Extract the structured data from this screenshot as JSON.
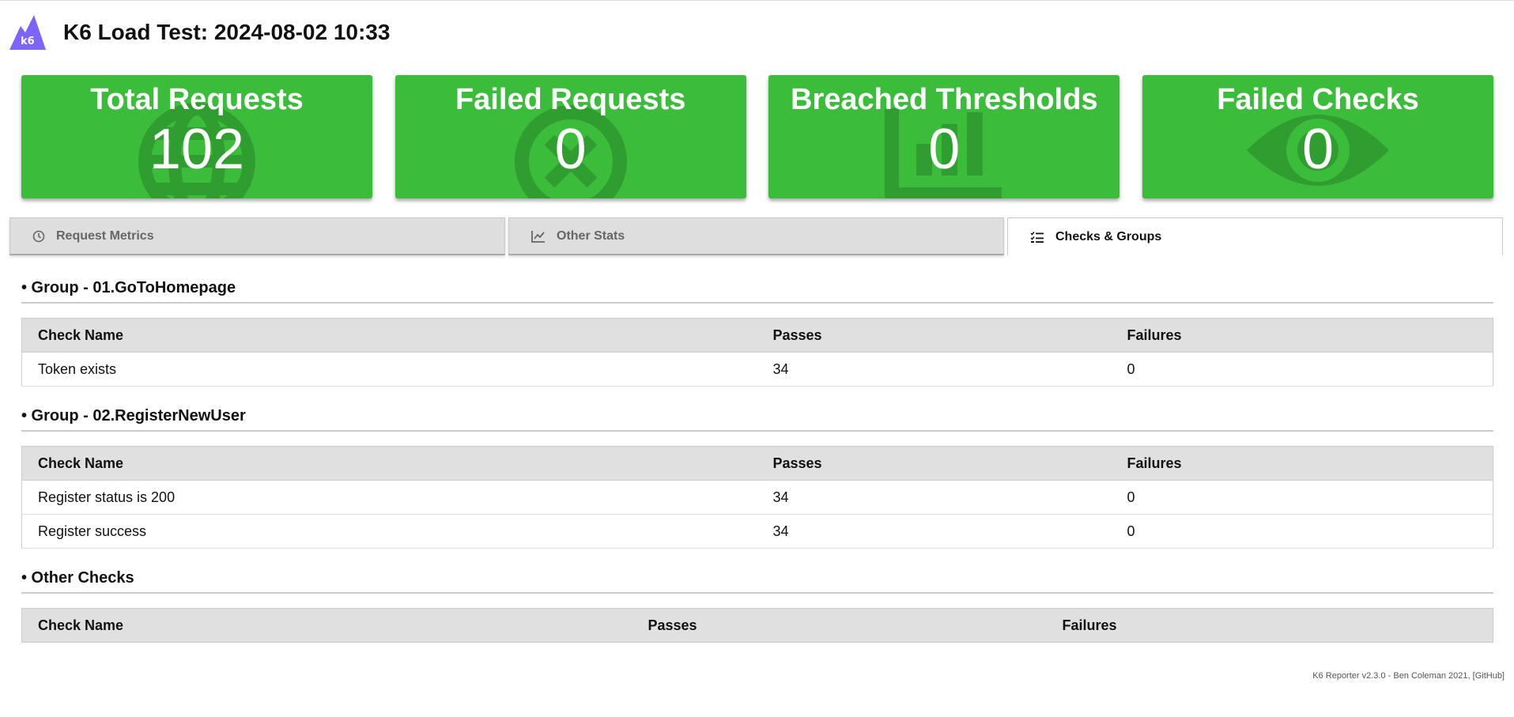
{
  "header": {
    "logo_text": "k6",
    "title": "K6 Load Test: 2024-08-02 10:33"
  },
  "cards": [
    {
      "title": "Total Requests",
      "value": "102",
      "icon": "globe-icon"
    },
    {
      "title": "Failed Requests",
      "value": "0",
      "icon": "x-circle-icon"
    },
    {
      "title": "Breached Thresholds",
      "value": "0",
      "icon": "bar-chart-icon"
    },
    {
      "title": "Failed Checks",
      "value": "0",
      "icon": "eye-icon"
    }
  ],
  "tabs": [
    {
      "label": "Request Metrics",
      "icon": "clock-icon",
      "active": false
    },
    {
      "label": "Other Stats",
      "icon": "line-chart-icon",
      "active": false
    },
    {
      "label": "Checks & Groups",
      "icon": "checklist-icon",
      "active": true
    }
  ],
  "groups": [
    {
      "title": "• Group - 01.GoToHomepage",
      "headers": [
        "Check Name",
        "Passes",
        "Failures"
      ],
      "rows": [
        [
          "Token exists",
          "34",
          "0"
        ]
      ]
    },
    {
      "title": "• Group - 02.RegisterNewUser",
      "headers": [
        "Check Name",
        "Passes",
        "Failures"
      ],
      "rows": [
        [
          "Register status is 200",
          "34",
          "0"
        ],
        [
          "Register success",
          "34",
          "0"
        ]
      ]
    }
  ],
  "other_checks": {
    "title": "• Other Checks",
    "headers": [
      "Check Name",
      "Passes",
      "Failures"
    ]
  },
  "footer": "K6 Reporter v2.3.0 - Ben Coleman 2021, [GitHub]",
  "colors": {
    "card_green": "#3bbd3b",
    "logo_purple": "#7d64ff"
  }
}
